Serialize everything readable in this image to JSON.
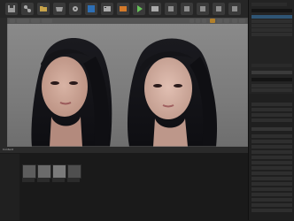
{
  "toolbar": {
    "buttons": [
      {
        "icon": "save-icon"
      },
      {
        "icon": "source-control-icon"
      },
      {
        "icon": "content-icon"
      },
      {
        "icon": "marketplace-icon"
      },
      {
        "icon": "settings-icon"
      },
      {
        "icon": "blueprints-icon"
      },
      {
        "icon": "cinematics-icon"
      },
      {
        "icon": "build-icon"
      },
      {
        "icon": "play-icon"
      },
      {
        "icon": "launch-icon"
      }
    ]
  },
  "viewport": {
    "left_character": "head-left",
    "right_character": "head-right"
  },
  "content_browser": {
    "tab_label": "Content",
    "thumbnails": 4
  }
}
